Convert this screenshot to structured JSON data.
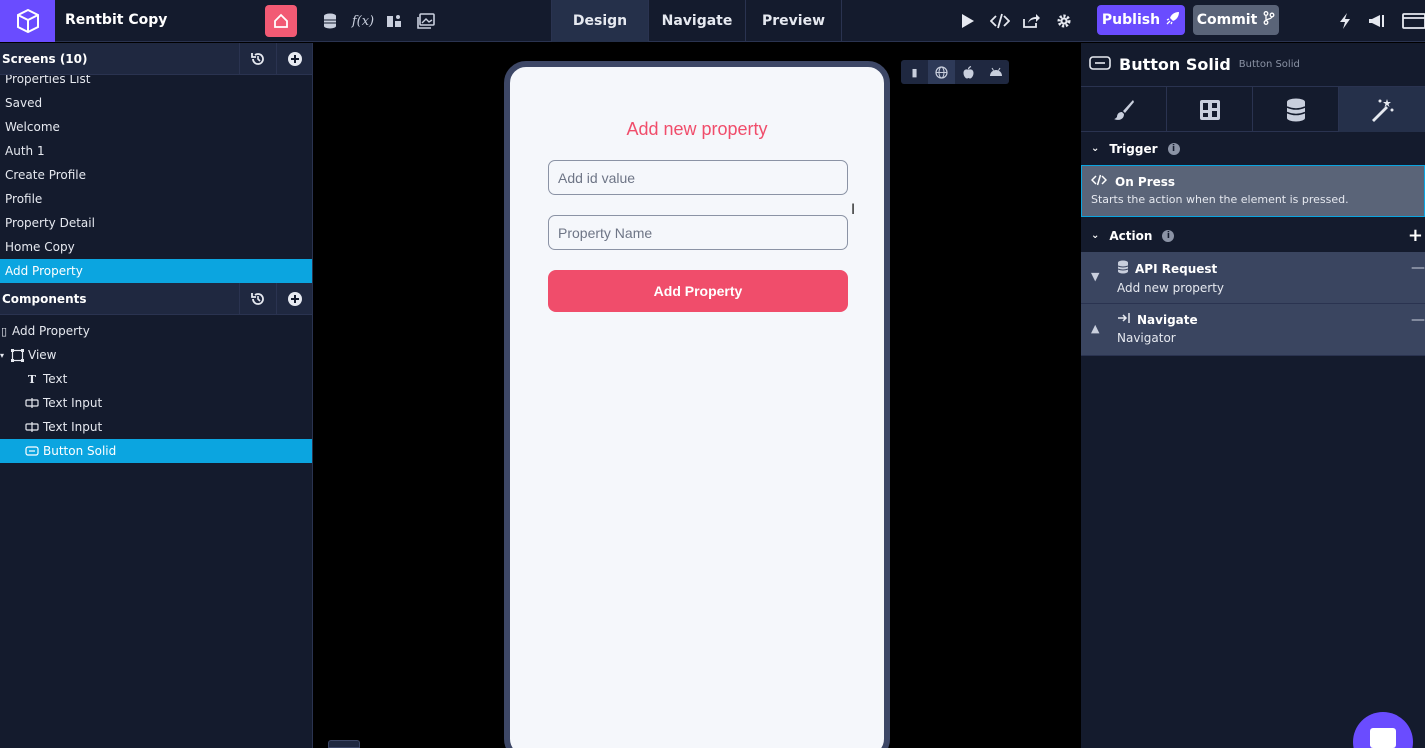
{
  "topbar": {
    "app_name": "Rentbit Copy",
    "tabs": [
      "Design",
      "Navigate",
      "Preview"
    ],
    "publish_label": "Publish",
    "commit_label": "Commit"
  },
  "screens": {
    "header": "Screens (10)",
    "items": [
      "Properties List",
      "Saved",
      "Welcome",
      "Auth 1",
      "Create Profile",
      "Profile",
      "Property Detail",
      "Home Copy",
      "Add Property"
    ],
    "selected": "Add Property"
  },
  "components": {
    "header": "Components",
    "tree": [
      {
        "label": "Add Property",
        "icon": "screen-icon",
        "indent": 0
      },
      {
        "label": "View",
        "icon": "view-icon",
        "indent": 1
      },
      {
        "label": "Text",
        "icon": "text-icon",
        "indent": 2
      },
      {
        "label": "Text Input",
        "icon": "text-input-icon",
        "indent": 2
      },
      {
        "label": "Text Input",
        "icon": "text-input-icon",
        "indent": 2
      },
      {
        "label": "Button Solid",
        "icon": "button-icon",
        "indent": 2
      }
    ]
  },
  "canvas": {
    "screen_title": "Add new property",
    "input_id_placeholder": "Add id value",
    "input_name_placeholder": "Property Name",
    "button_label": "Add Property"
  },
  "inspector": {
    "component_name": "Button Solid",
    "component_type": "Button Solid",
    "trigger_header": "Trigger",
    "trigger_name": "On Press",
    "trigger_desc": "Starts the action when the element is pressed.",
    "action_header": "Action",
    "actions": [
      {
        "title": "API Request",
        "subtitle": "Add new property"
      },
      {
        "title": "Navigate",
        "subtitle": "Navigator"
      }
    ]
  },
  "colors": {
    "accent": "#6a4cff",
    "selection": "#0ba5e0",
    "brand_pink": "#f04d6b"
  }
}
